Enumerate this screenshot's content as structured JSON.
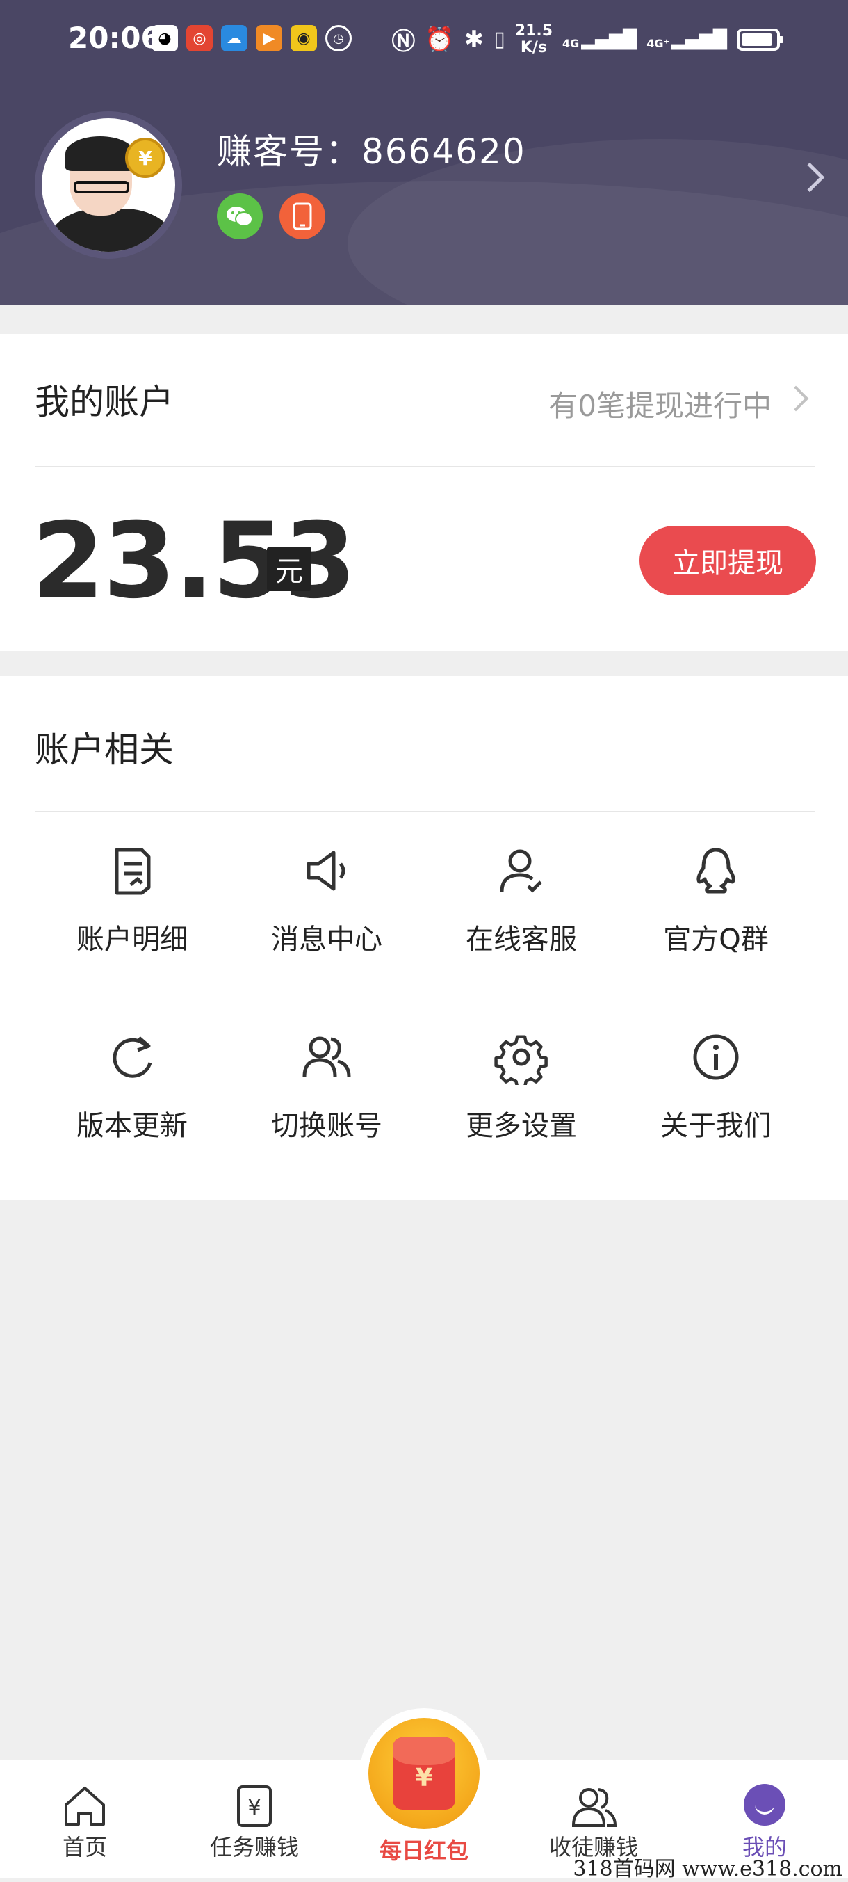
{
  "status_bar": {
    "time": "20:06",
    "net_speed": "21.5\nK/s",
    "net_speed_value": "21.5",
    "net_speed_unit": "K/s",
    "signal1": "4G",
    "signal2": "4G⁺",
    "app_icons": [
      "qq-icon",
      "weibo-icon",
      "weather-icon",
      "video-icon",
      "game-icon",
      "clock-badge-icon"
    ]
  },
  "profile": {
    "account_label": "赚客号：8664620"
  },
  "account": {
    "title": "我的账户",
    "pending": "有0笔提现进行中",
    "balance": "23.53",
    "currency": "元",
    "withdraw_label": "立即提现"
  },
  "related": {
    "title": "账户相关",
    "items": [
      {
        "label": "账户明细",
        "icon": "document-icon"
      },
      {
        "label": "消息中心",
        "icon": "megaphone-icon"
      },
      {
        "label": "在线客服",
        "icon": "support-user-icon"
      },
      {
        "label": "官方Q群",
        "icon": "qq-penguin-icon"
      },
      {
        "label": "版本更新",
        "icon": "refresh-icon"
      },
      {
        "label": "切换账号",
        "icon": "users-icon"
      },
      {
        "label": "更多设置",
        "icon": "gear-icon"
      },
      {
        "label": "关于我们",
        "icon": "info-icon"
      }
    ]
  },
  "nav": {
    "items": [
      {
        "label": "首页",
        "icon": "home-icon"
      },
      {
        "label": "任务赚钱",
        "icon": "task-money-icon"
      },
      {
        "label": "每日红包",
        "icon": "red-envelope-icon"
      },
      {
        "label": "收徒赚钱",
        "icon": "apprentice-icon"
      },
      {
        "label": "我的",
        "icon": "mine-icon"
      }
    ]
  },
  "watermark": "318首码网 www.e318.com",
  "colors": {
    "header_bg": "#4a4664",
    "accent_red": "#ea4b4f",
    "active_purple": "#6b4fb6"
  }
}
